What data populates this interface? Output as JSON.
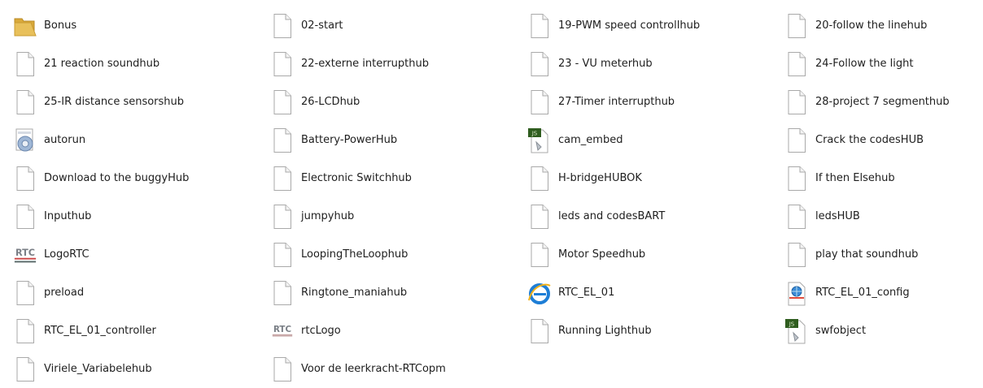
{
  "files": [
    {
      "name": "Bonus",
      "icon": "folder-icon"
    },
    {
      "name": "02-start",
      "icon": "file-icon"
    },
    {
      "name": "19-PWM speed controllhub",
      "icon": "file-icon"
    },
    {
      "name": "20-follow the linehub",
      "icon": "file-icon"
    },
    {
      "name": "21 reaction soundhub",
      "icon": "file-icon"
    },
    {
      "name": "22-externe interrupthub",
      "icon": "file-icon"
    },
    {
      "name": "23 - VU meterhub",
      "icon": "file-icon"
    },
    {
      "name": "24-Follow the light",
      "icon": "file-icon"
    },
    {
      "name": "25-IR distance sensorshub",
      "icon": "file-icon"
    },
    {
      "name": "26-LCDhub",
      "icon": "file-icon"
    },
    {
      "name": "27-Timer interrupthub",
      "icon": "file-icon"
    },
    {
      "name": "28-project 7 segmenthub",
      "icon": "file-icon"
    },
    {
      "name": "autorun",
      "icon": "settings-file-icon"
    },
    {
      "name": "Battery-PowerHub",
      "icon": "file-icon"
    },
    {
      "name": "cam_embed",
      "icon": "js-file-icon"
    },
    {
      "name": "Crack the codesHUB",
      "icon": "file-icon"
    },
    {
      "name": "Download to the buggyHub",
      "icon": "file-icon"
    },
    {
      "name": "Electronic Switchhub",
      "icon": "file-icon"
    },
    {
      "name": "H-bridgeHUBOK",
      "icon": "file-icon"
    },
    {
      "name": "If then Elsehub",
      "icon": "file-icon"
    },
    {
      "name": "Inputhub",
      "icon": "file-icon"
    },
    {
      "name": "jumpyhub",
      "icon": "file-icon"
    },
    {
      "name": "leds and codesBART",
      "icon": "file-icon"
    },
    {
      "name": "ledsHUB",
      "icon": "file-icon"
    },
    {
      "name": "LogoRTC",
      "icon": "rtc-logo-icon"
    },
    {
      "name": "LoopingTheLoophub",
      "icon": "file-icon"
    },
    {
      "name": "Motor Speedhub",
      "icon": "file-icon"
    },
    {
      "name": "play that soundhub",
      "icon": "file-icon"
    },
    {
      "name": "preload",
      "icon": "file-icon"
    },
    {
      "name": "Ringtone_maniahub",
      "icon": "file-icon"
    },
    {
      "name": "RTC_EL_01",
      "icon": "internet-explorer-icon"
    },
    {
      "name": "RTC_EL_01_config",
      "icon": "xml-config-icon"
    },
    {
      "name": "RTC_EL_01_controller",
      "icon": "file-icon"
    },
    {
      "name": "rtcLogo",
      "icon": "rtc-logo-small-icon"
    },
    {
      "name": "Running Lighthub",
      "icon": "file-icon"
    },
    {
      "name": "swfobject",
      "icon": "js-file-icon"
    },
    {
      "name": "Viriele_Variabelehub",
      "icon": "file-icon"
    },
    {
      "name": "Voor de leerkracht-RTCopm",
      "icon": "file-icon"
    }
  ],
  "colors": {
    "folder": "#e8c05a",
    "page_border": "#a9a9a9",
    "js_badge": "#2f5d1f",
    "rtc_text": "#7a7f86",
    "ie_blue": "#1e7ed6",
    "ie_ring": "#f0b21c"
  },
  "icon_texts": {
    "js_badge": "JS",
    "rtc_logo": "RTC"
  }
}
